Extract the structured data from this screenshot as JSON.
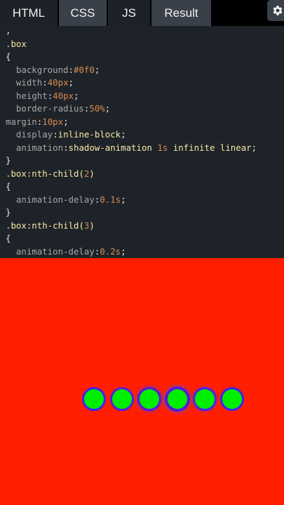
{
  "tabs": [
    {
      "label": "HTML"
    },
    {
      "label": "CSS"
    },
    {
      "label": "JS"
    },
    {
      "label": "Result"
    }
  ],
  "settings_icon": "gear-icon",
  "code_lines": [
    [
      {
        "t": ",",
        "c": "punc"
      }
    ],
    [
      {
        "t": ".box",
        "c": "sel"
      }
    ],
    [
      {
        "t": "{",
        "c": "punc"
      }
    ],
    [
      {
        "t": "  background",
        "c": "prop"
      },
      {
        "t": ":",
        "c": "punc"
      },
      {
        "t": "#0f0",
        "c": "num"
      },
      {
        "t": ";",
        "c": "punc"
      }
    ],
    [
      {
        "t": "  width",
        "c": "prop"
      },
      {
        "t": ":",
        "c": "punc"
      },
      {
        "t": "40px",
        "c": "num"
      },
      {
        "t": ";",
        "c": "punc"
      }
    ],
    [
      {
        "t": "  height",
        "c": "prop"
      },
      {
        "t": ":",
        "c": "punc"
      },
      {
        "t": "40px",
        "c": "num"
      },
      {
        "t": ";",
        "c": "punc"
      }
    ],
    [
      {
        "t": "  border-radius",
        "c": "prop"
      },
      {
        "t": ":",
        "c": "punc"
      },
      {
        "t": "50%",
        "c": "num"
      },
      {
        "t": ";",
        "c": "punc"
      }
    ],
    [
      {
        "t": "margin",
        "c": "prop"
      },
      {
        "t": ":",
        "c": "punc"
      },
      {
        "t": "10px",
        "c": "num"
      },
      {
        "t": ";",
        "c": "punc"
      }
    ],
    [
      {
        "t": "  display",
        "c": "prop"
      },
      {
        "t": ":",
        "c": "punc"
      },
      {
        "t": "inline-block",
        "c": "kw"
      },
      {
        "t": ";",
        "c": "punc"
      }
    ],
    [
      {
        "t": "  animation",
        "c": "prop"
      },
      {
        "t": ":",
        "c": "punc"
      },
      {
        "t": "shadow-animation ",
        "c": "kw"
      },
      {
        "t": "1s",
        "c": "num"
      },
      {
        "t": " infinite linear",
        "c": "kw"
      },
      {
        "t": ";",
        "c": "punc"
      }
    ],
    [
      {
        "t": "}",
        "c": "punc"
      }
    ],
    [
      {
        "t": ".box",
        "c": "sel"
      },
      {
        "t": ":nth-child(",
        "c": "kw"
      },
      {
        "t": "2",
        "c": "num"
      },
      {
        "t": ")",
        "c": "kw"
      }
    ],
    [
      {
        "t": "{",
        "c": "punc"
      }
    ],
    [
      {
        "t": "  animation-delay",
        "c": "prop"
      },
      {
        "t": ":",
        "c": "punc"
      },
      {
        "t": "0.1s",
        "c": "num"
      },
      {
        "t": ";",
        "c": "punc"
      }
    ],
    [
      {
        "t": "}",
        "c": "punc"
      }
    ],
    [
      {
        "t": ".box",
        "c": "sel"
      },
      {
        "t": ":nth-child(",
        "c": "kw"
      },
      {
        "t": "3",
        "c": "num"
      },
      {
        "t": ")",
        "c": "kw"
      }
    ],
    [
      {
        "t": "{",
        "c": "punc"
      }
    ],
    [
      {
        "t": "  animation-delay",
        "c": "prop"
      },
      {
        "t": ":",
        "c": "punc"
      },
      {
        "t": "0.2s",
        "c": "num"
      },
      {
        "t": ";",
        "c": "punc"
      }
    ]
  ],
  "result": {
    "background": "#ff1f00",
    "box_color": "#00ee00",
    "shadow_color": "#3d20ff",
    "box_count": 6
  }
}
